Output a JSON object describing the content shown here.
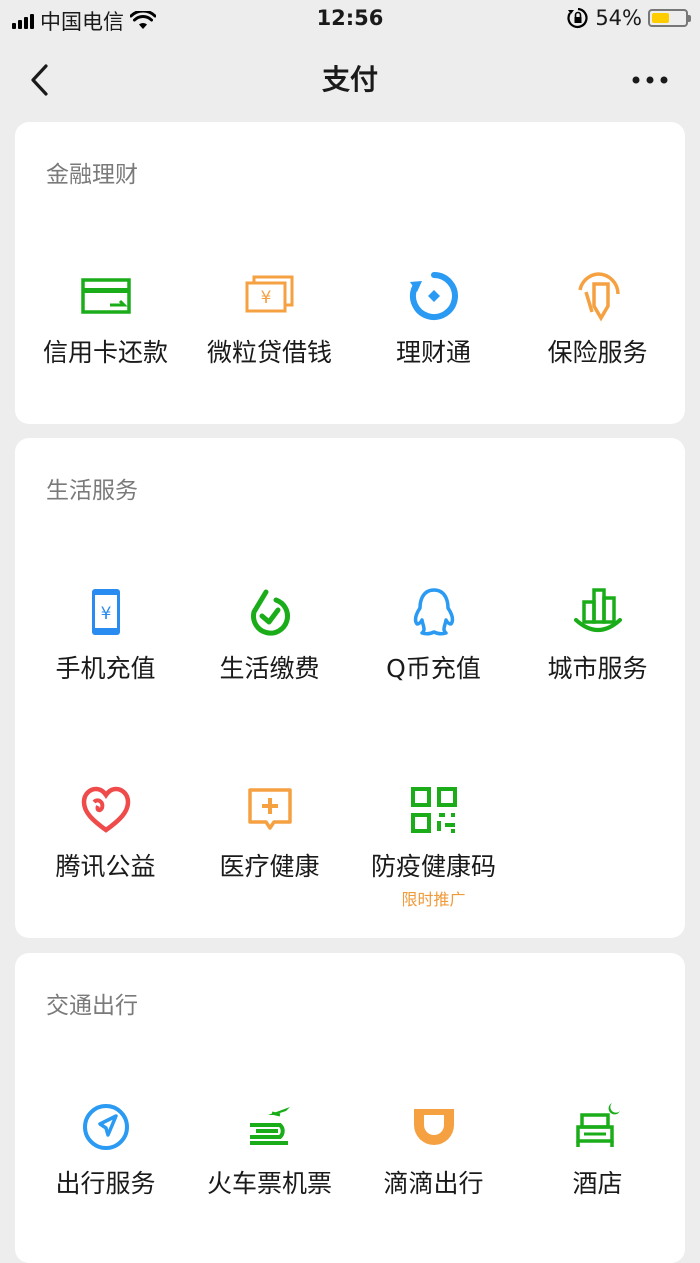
{
  "status_bar": {
    "carrier": "中国电信",
    "time": "12:56",
    "battery_percent_text": "54%",
    "battery_level": 0.54
  },
  "nav": {
    "title": "支付"
  },
  "sections": {
    "finance": {
      "title": "金融理财",
      "items": [
        {
          "label": "信用卡还款",
          "icon": "credit-card-icon",
          "color": "#1aad19"
        },
        {
          "label": "微粒贷借钱",
          "icon": "yuan-cards-icon",
          "color": "#f5a142"
        },
        {
          "label": "理财通",
          "icon": "wealth-circle-icon",
          "color": "#2a9af3"
        },
        {
          "label": "保险服务",
          "icon": "umbrella-shield-icon",
          "color": "#f5a142"
        }
      ]
    },
    "life": {
      "title": "生活服务",
      "items": [
        {
          "label": "手机充值",
          "icon": "phone-yuan-icon",
          "color": "#2a8cf0"
        },
        {
          "label": "生活缴费",
          "icon": "checkmark-circle-icon",
          "color": "#1aad19"
        },
        {
          "label": "Q币充值",
          "icon": "qq-penguin-icon",
          "color": "#2a9af3"
        },
        {
          "label": "城市服务",
          "icon": "city-buildings-icon",
          "color": "#1aad19"
        },
        {
          "label": "腾讯公益",
          "icon": "charity-heart-icon",
          "color": "#ef4b4b"
        },
        {
          "label": "医疗健康",
          "icon": "medical-cross-icon",
          "color": "#f5a142"
        },
        {
          "label": "防疫健康码",
          "icon": "qr-code-icon",
          "color": "#1aad19",
          "sub": "限时推广"
        }
      ]
    },
    "transport": {
      "title": "交通出行",
      "items": [
        {
          "label": "出行服务",
          "icon": "navigation-arrow-icon",
          "color": "#2a9af3"
        },
        {
          "label": "火车票机票",
          "icon": "train-plane-icon",
          "color": "#1aad19"
        },
        {
          "label": "滴滴出行",
          "icon": "didi-icon",
          "color": "#f5a142"
        },
        {
          "label": "酒店",
          "icon": "hotel-bed-icon",
          "color": "#1aad19"
        }
      ]
    }
  }
}
